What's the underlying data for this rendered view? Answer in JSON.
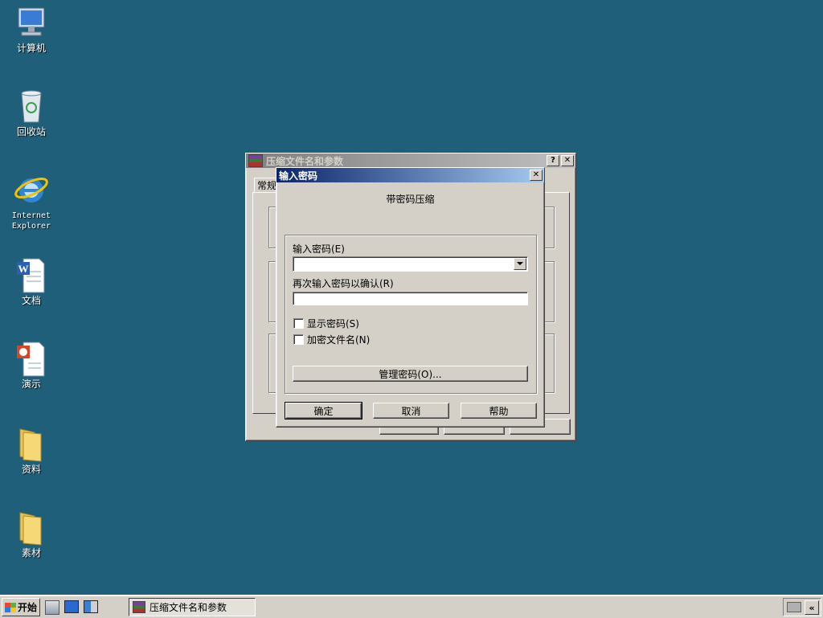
{
  "desktop": {
    "icons": [
      {
        "label": "计算机",
        "icon": "computer-icon"
      },
      {
        "label": "回收站",
        "icon": "recycle-bin-icon"
      },
      {
        "label": "Internet\nExplorer",
        "icon": "internet-explorer-icon"
      },
      {
        "label": "文档",
        "icon": "word-document-icon"
      },
      {
        "label": "演示",
        "icon": "powerpoint-icon"
      },
      {
        "label": "资料",
        "icon": "folder-icon"
      },
      {
        "label": "素材",
        "icon": "folder-icon"
      }
    ]
  },
  "back_window": {
    "title": "压缩文件名和参数",
    "tab_label": "常规",
    "help_btn": "?",
    "close_btn": "✕"
  },
  "dialog": {
    "title": "输入密码",
    "close_btn": "✕",
    "heading": "带密码压缩",
    "password_label": "输入密码(E)",
    "password_value": "",
    "confirm_label": "再次输入密码以确认(R)",
    "confirm_value": "",
    "show_password_label": "显示密码(S)",
    "encrypt_names_label": "加密文件名(N)",
    "manage_button": "管理密码(O)...",
    "ok_button": "确定",
    "cancel_button": "取消",
    "help_button": "帮助"
  },
  "taskbar": {
    "start_label": "开始",
    "task_label": "压缩文件名和参数"
  },
  "colors": {
    "desktop_bg": "#1f5f7a",
    "title_active": "#0a246a",
    "face": "#d4d0c8"
  }
}
